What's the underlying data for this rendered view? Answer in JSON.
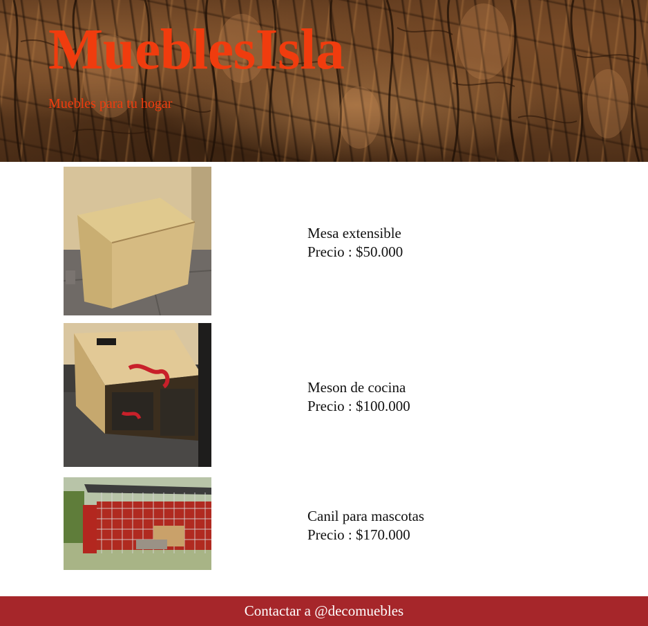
{
  "header": {
    "title": "MueblesIsla",
    "tagline": "Muebles para tu hogar"
  },
  "products": [
    {
      "name": "Mesa extensible",
      "price": "Precio : $50.000"
    },
    {
      "name": "Meson de cocina",
      "price": "Precio : $100.000"
    },
    {
      "name": "Canil para mascotas",
      "price": "Precio : $170.000"
    }
  ],
  "footer": {
    "contact": "Contactar a @decomuebles"
  },
  "colors": {
    "title": "#f03c0e",
    "footer_bg": "#a6262a",
    "footer_text": "#ffffff"
  }
}
